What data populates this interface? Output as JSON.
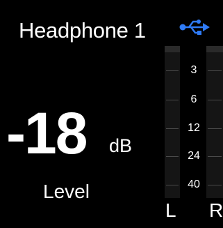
{
  "header": {
    "title": "Headphone 1",
    "connection_icon": "usb-icon",
    "accent_color": "#2f7bf6"
  },
  "level": {
    "value": "-18",
    "unit": "dB",
    "label": "Level"
  },
  "meter": {
    "scale_labels": [
      "3",
      "6",
      "12",
      "24",
      "40"
    ],
    "channels": {
      "left": "L",
      "right": "R"
    }
  }
}
